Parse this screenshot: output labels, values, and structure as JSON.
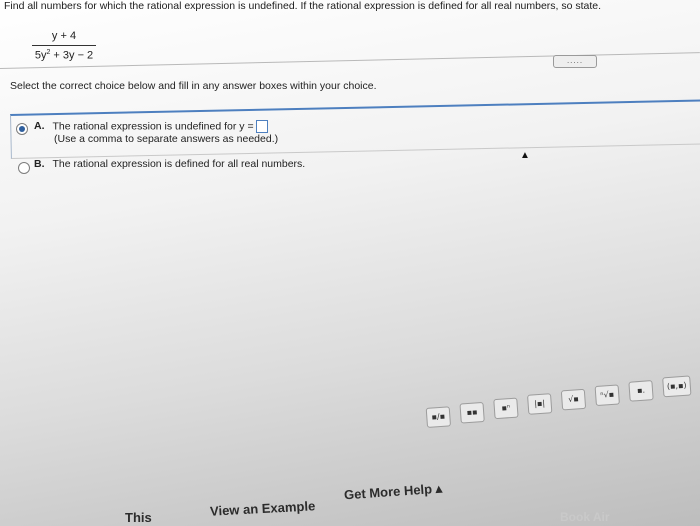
{
  "question": {
    "prompt": "Find all numbers for which the rational expression is undefined. If the rational expression is defined for all real numbers, so state.",
    "numerator": "y + 4",
    "denominator_base": "5y",
    "denominator_exp": "2",
    "denominator_rest": " + 3y − 2",
    "more_button": "....."
  },
  "instruction": "Select the correct choice below and fill in any answer boxes within your choice.",
  "choices": [
    {
      "letter": "A.",
      "text": "The rational expression is undefined for y =",
      "hint": "(Use a comma to separate answers as needed.)",
      "selected": true
    },
    {
      "letter": "B.",
      "text": "The rational expression is defined for all real numbers.",
      "selected": false
    }
  ],
  "toolbar": {
    "buttons": [
      {
        "icon": "fraction-icon",
        "glyph": "▪/▪"
      },
      {
        "icon": "mixed-number-icon",
        "glyph": "▪▪"
      },
      {
        "icon": "exponent-icon",
        "glyph": "▪ⁿ"
      },
      {
        "icon": "absolute-value-icon",
        "glyph": "|▪|"
      },
      {
        "icon": "square-root-icon",
        "glyph": "√▪"
      },
      {
        "icon": "nth-root-icon",
        "glyph": "ⁿ√▪"
      },
      {
        "icon": "decimal-icon",
        "glyph": "▪."
      },
      {
        "icon": "ordered-pair-icon",
        "glyph": "(▪,▪)"
      }
    ]
  },
  "footer": {
    "partial_link": "This",
    "view_example": "View an Example",
    "get_more_help": "Get More Help ▴"
  },
  "bezel_text": "Book Air"
}
